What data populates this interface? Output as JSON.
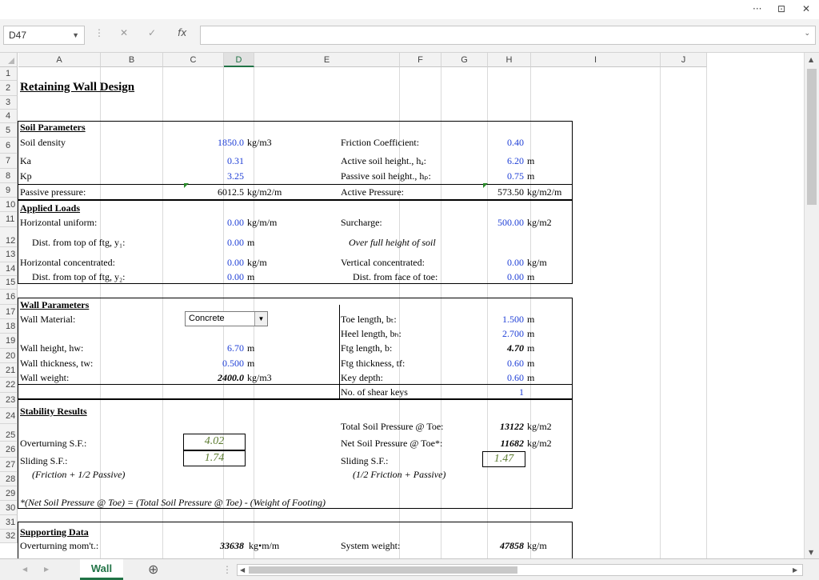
{
  "window": {
    "more": "···",
    "restore": "⊡",
    "close": "✕"
  },
  "formula_bar": {
    "name_box": "D47",
    "formula": "",
    "fx": "fx",
    "cancel": "✕",
    "enter": "✓"
  },
  "columns": [
    "A",
    "B",
    "C",
    "D",
    "E",
    "F",
    "G",
    "H",
    "I",
    "J"
  ],
  "selected_column": "D",
  "rows": [
    "1",
    "2",
    "3",
    "4",
    "5",
    "6",
    "7",
    "8",
    "9",
    "10",
    "11",
    "12",
    "13",
    "14",
    "15",
    "16",
    "17",
    "18",
    "19",
    "20",
    "21",
    "22",
    "23",
    "24",
    "25",
    "26",
    "27",
    "28",
    "29",
    "30",
    "31",
    "32"
  ],
  "sheet": {
    "title": "Retaining Wall Design",
    "soil_params": "Soil Parameters",
    "soil_density": "Soil density",
    "soil_density_val": "1850.0",
    "soil_density_unit": "kg/m3",
    "ka": "Ka",
    "ka_val": "0.31",
    "kp": "Kp",
    "kp_val": "3.25",
    "passive_pressure": "Passive pressure:",
    "passive_pressure_val": "6012.5",
    "passive_pressure_unit": "kg/m2/m",
    "friction_coef": "Friction Coefficient:",
    "friction_coef_val": "0.40",
    "active_height": "Active soil height., hₐ:",
    "active_height_val": "6.20",
    "active_height_unit": "m",
    "passive_height": "Passive soil height., hₚ:",
    "passive_height_val": "0.75",
    "passive_height_unit": "m",
    "active_pressure": "Active Pressure:",
    "active_pressure_val": "573.50",
    "active_pressure_unit": "kg/m2/m",
    "applied_loads": "Applied Loads",
    "horiz_uniform": "Horizontal uniform:",
    "horiz_uniform_val": "0.00",
    "horiz_uniform_unit": "kg/m/m",
    "dist_y1": "Dist. from top of ftg, y₁:",
    "dist_y1_val": "0.00",
    "dist_y1_unit": "m",
    "horiz_conc": "Horizontal concentrated:",
    "horiz_conc_val": "0.00",
    "horiz_conc_unit": "kg/m",
    "dist_y2": "Dist. from top of ftg, y₂:",
    "dist_y2_val": "0.00",
    "dist_y2_unit": "m",
    "surcharge": "Surcharge:",
    "surcharge_val": "500.00",
    "surcharge_unit": "kg/m2",
    "over_full": "Over full height of soil",
    "vert_conc": "Vertical concentrated:",
    "vert_conc_val": "0.00",
    "vert_conc_unit": "kg/m",
    "dist_face": "Dist. from face of toe:",
    "dist_face_val": "0.00",
    "dist_face_unit": "m",
    "wall_params": "Wall Parameters",
    "wall_material": "Wall Material:",
    "wall_material_val": "Concrete",
    "wall_height": "Wall height, hw:",
    "wall_height_val": "6.70",
    "wall_height_unit": "m",
    "wall_thickness": "Wall thickness, tw:",
    "wall_thickness_val": "0.500",
    "wall_thickness_unit": "m",
    "wall_weight": "Wall weight:",
    "wall_weight_val": "2400.0",
    "wall_weight_unit": "kg/m3",
    "toe_length": "Toe length, bₜ:",
    "toe_length_val": "1.500",
    "toe_length_unit": "m",
    "heel_length": "Heel length, bₕ:",
    "heel_length_val": "2.700",
    "heel_length_unit": "m",
    "ftg_length": "Ftg length, b:",
    "ftg_length_val": "4.70",
    "ftg_length_unit": "m",
    "ftg_thickness": "Ftg thickness, tf:",
    "ftg_thickness_val": "0.60",
    "ftg_thickness_unit": "m",
    "key_depth": "Key depth:",
    "key_depth_val": "0.60",
    "key_depth_unit": "m",
    "shear_keys": "No. of shear keys",
    "shear_keys_val": "1",
    "stability": "Stability Results",
    "overturning": "Overturning S.F.:",
    "overturning_val": "4.02",
    "sliding": "Sliding S.F.:",
    "sliding_val": "1.74",
    "friction_note": "(Friction + 1/2 Passive)",
    "total_soil": "Total Soil Pressure @ Toe:",
    "total_soil_val": "13122",
    "total_soil_unit": "kg/m2",
    "net_soil": "Net Soil Pressure @ Toe*:",
    "net_soil_val": "11682",
    "net_soil_unit": "kg/m2",
    "sliding2": "Sliding S.F.:",
    "sliding2_val": "1.47",
    "passive_note": "(1/2 Friction + Passive)",
    "footnote": "*(Net Soil Pressure @ Toe) = (Total Soil Pressure @ Toe) - (Weight of Footing)",
    "supporting": "Supporting Data",
    "overturning_mom": "Overturning mom't.:",
    "overturning_mom_val": "33638",
    "overturning_mom_unit": "kg•m/m",
    "system_weight": "System weight:",
    "system_weight_val": "47858",
    "system_weight_unit": "kg/m"
  },
  "tabs": {
    "active": "Wall",
    "add": "⊕"
  }
}
